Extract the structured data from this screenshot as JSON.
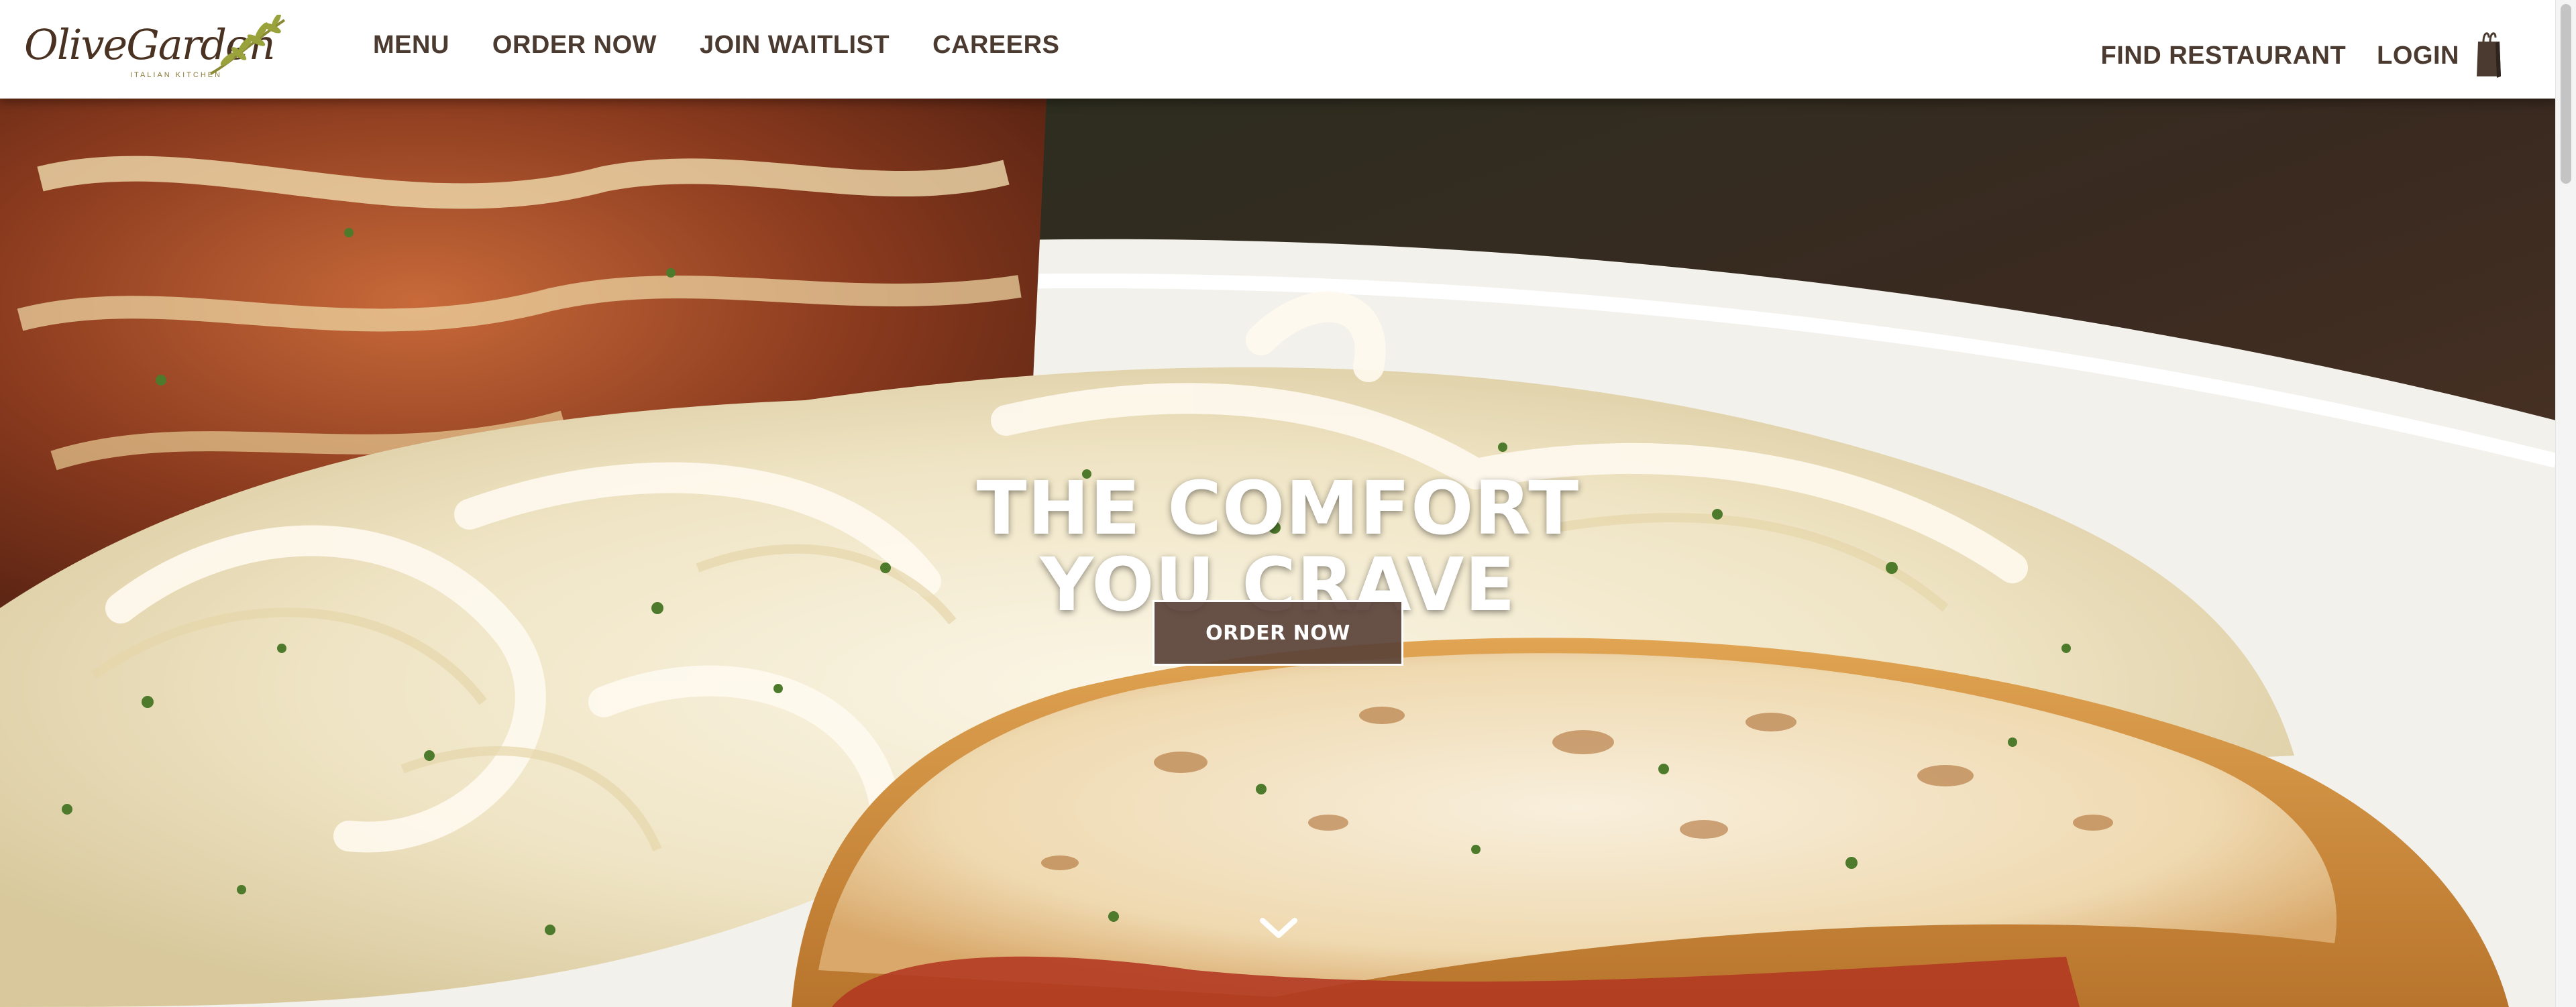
{
  "brand": {
    "logo_text": "OliveGarden",
    "logo_tagline": "ITALIAN KITCHEN"
  },
  "nav": {
    "items": [
      {
        "label": "MENU"
      },
      {
        "label": "ORDER NOW"
      },
      {
        "label": "JOIN WAITLIST"
      },
      {
        "label": "CAREERS"
      }
    ]
  },
  "utility": {
    "find_restaurant": "FIND RESTAURANT",
    "login": "LOGIN",
    "bag_icon": "shopping-bag-icon"
  },
  "hero": {
    "title_line1": "THE COMFORT",
    "title_line2": "YOU CRAVE",
    "cta_label": "ORDER NOW",
    "scroll_icon": "chevron-down-icon"
  },
  "colors": {
    "brand_brown": "#4a3a30",
    "cta_bg": "#5a4238",
    "header_bg": "#ffffff"
  }
}
